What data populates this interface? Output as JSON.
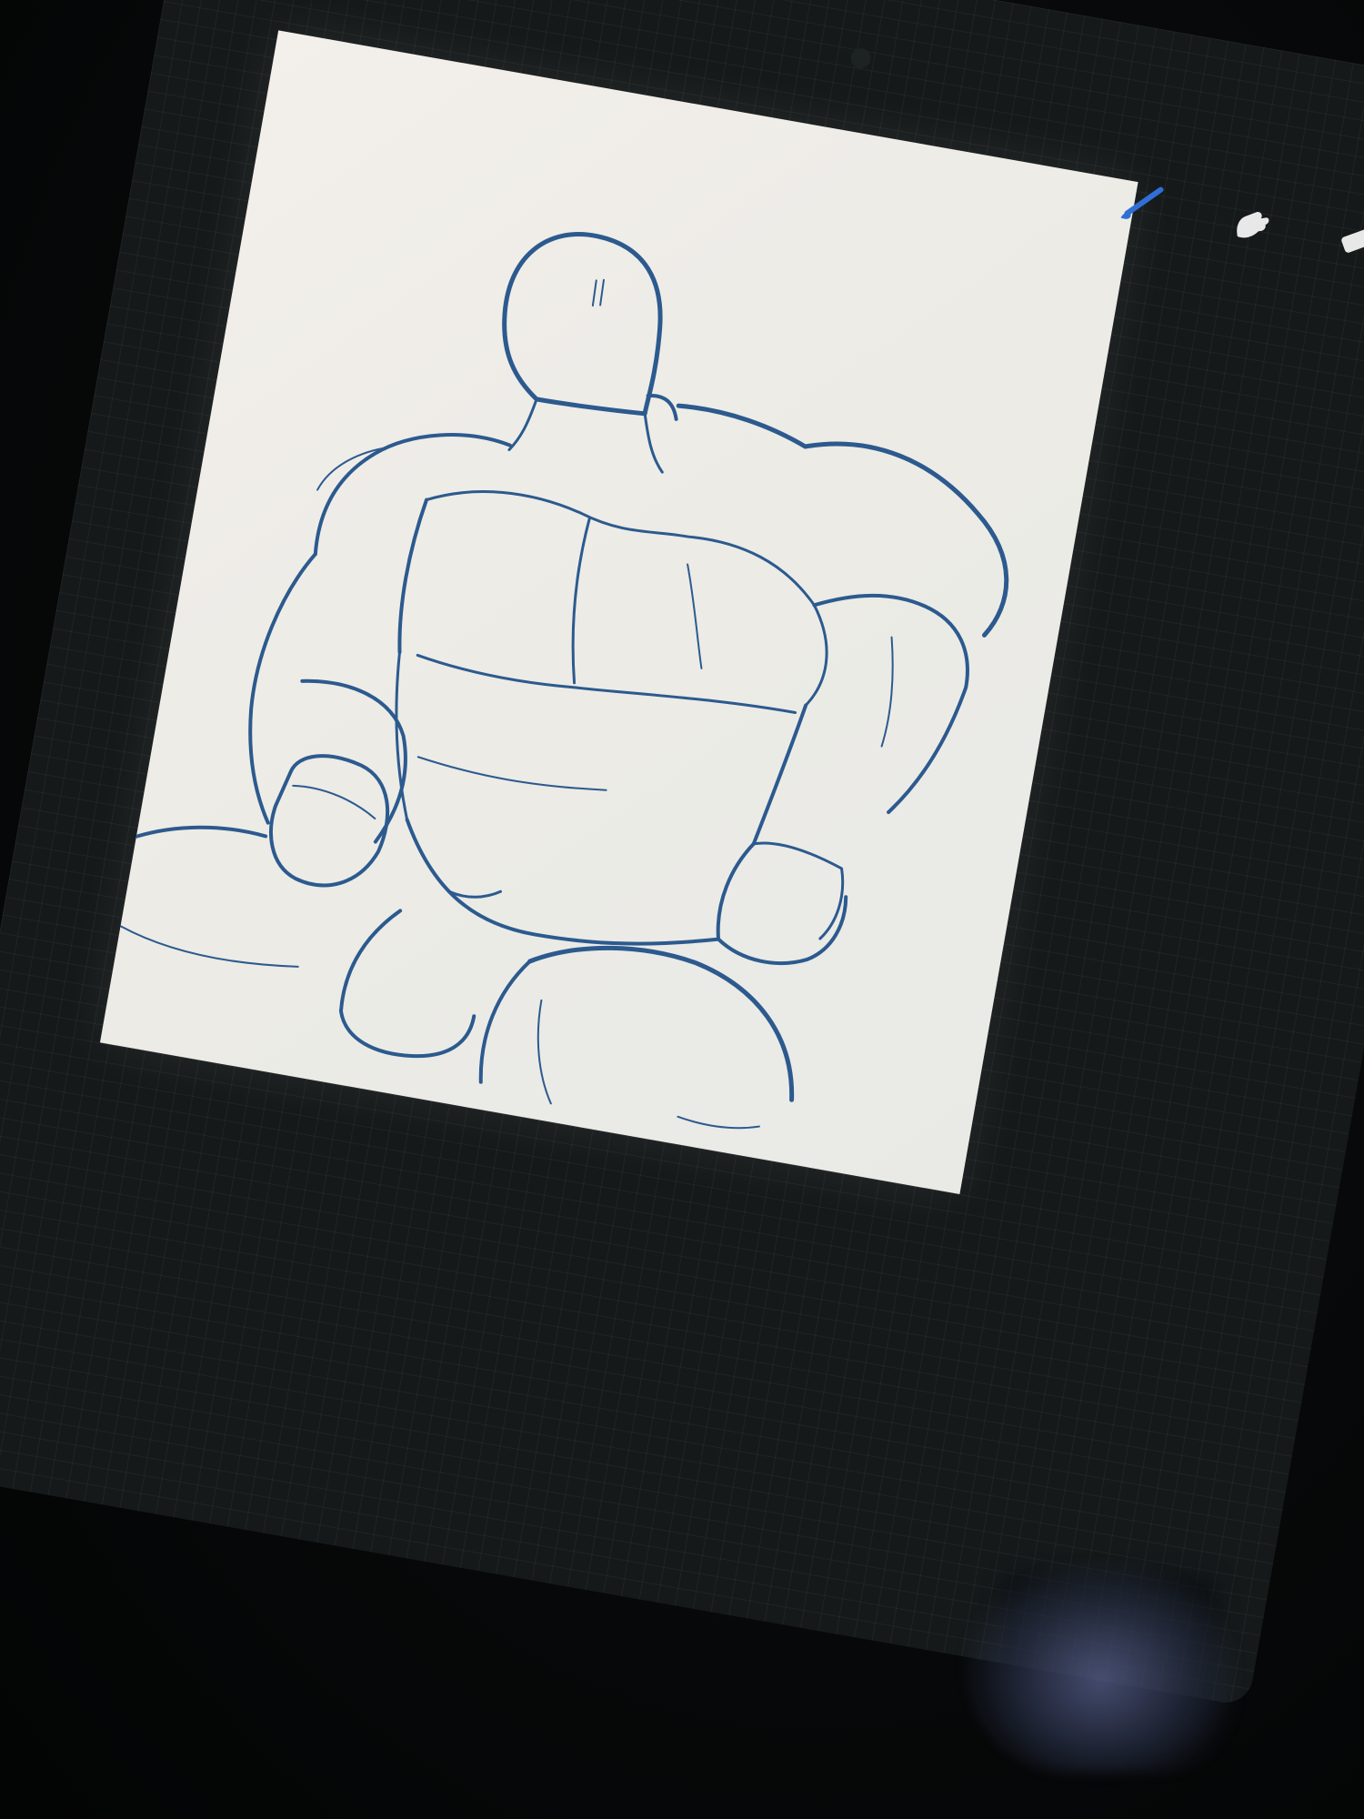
{
  "toolbar": {
    "tools": [
      {
        "id": "brush",
        "icon": "paintbrush-icon",
        "active": true,
        "color": "#2f6fd6"
      },
      {
        "id": "smudge",
        "icon": "smudge-finger-icon",
        "active": false,
        "color": "#e8e8e8"
      },
      {
        "id": "eraser",
        "icon": "eraser-icon",
        "active": false,
        "color": "#e8e8e8"
      },
      {
        "id": "layers",
        "icon": "layers-icon",
        "active": false,
        "color": "#e8e8e8"
      }
    ]
  },
  "canvas": {
    "paper_color": "#efece7",
    "stroke_color": "#2c5a8e",
    "background_grid": true
  }
}
